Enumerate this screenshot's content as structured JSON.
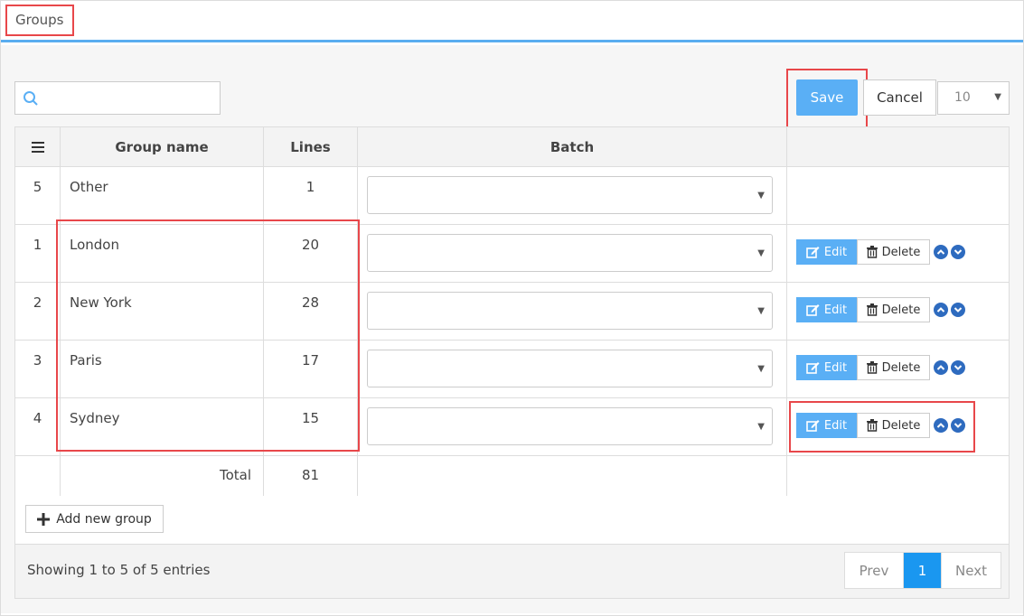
{
  "header": {
    "title": "Groups"
  },
  "toolbar": {
    "search_placeholder": "",
    "save_label": "Save",
    "cancel_label": "Cancel",
    "page_size": "10"
  },
  "table": {
    "columns": [
      "",
      "Group name",
      "Lines",
      "Batch",
      ""
    ],
    "rows": [
      {
        "order": "5",
        "name": "Other",
        "lines": "1",
        "has_actions": false
      },
      {
        "order": "1",
        "name": "London",
        "lines": "20",
        "has_actions": true
      },
      {
        "order": "2",
        "name": "New York",
        "lines": "28",
        "has_actions": true
      },
      {
        "order": "3",
        "name": "Paris",
        "lines": "17",
        "has_actions": true
      },
      {
        "order": "4",
        "name": "Sydney",
        "lines": "15",
        "has_actions": true
      }
    ],
    "total_label": "Total",
    "total_value": "81",
    "edit_label": "Edit",
    "delete_label": "Delete"
  },
  "add_group_label": "Add new group",
  "footer": {
    "info": "Showing 1 to 5 of 5 entries",
    "prev_label": "Prev",
    "current_page": "1",
    "next_label": "Next"
  },
  "colors": {
    "accent": "#5aaff5",
    "active_page": "#1a97f0",
    "highlight": "#e8474a",
    "icon_blue": "#2e6bbf"
  }
}
